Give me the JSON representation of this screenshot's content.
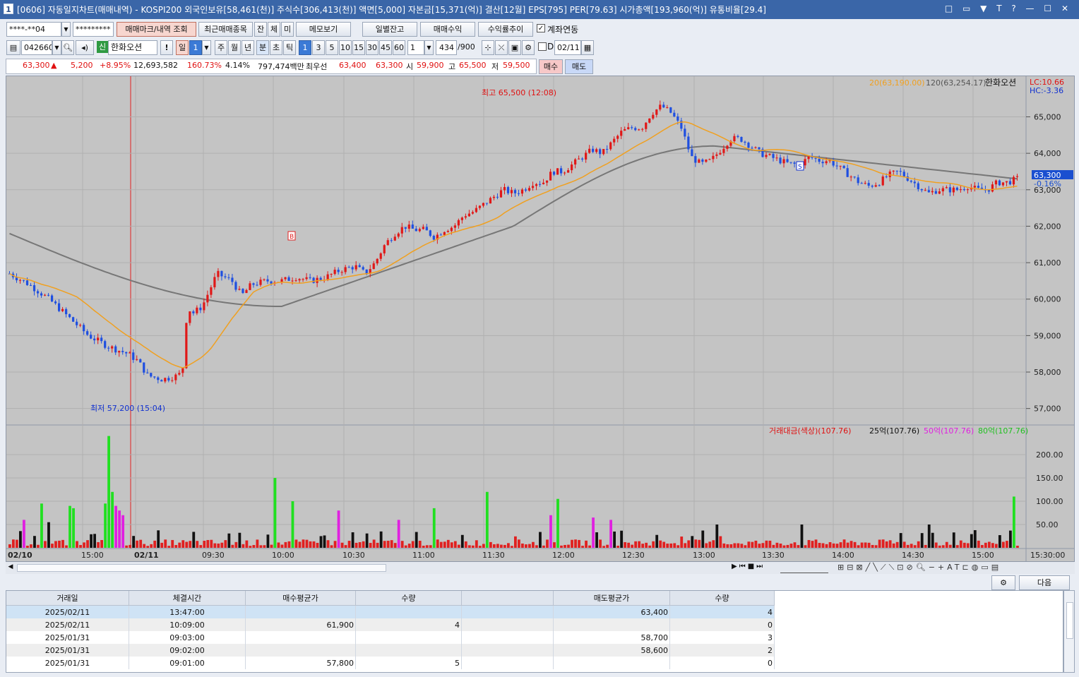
{
  "window": {
    "number": "1",
    "title": "[0606] 자동일지차트(매매내역) - KOSPI200 외국인보유[58,461(천)] 주식수[306,413(천)] 액면[5,000] 자본금[15,371(억)] 결산[12월] EPS[795] PER[79.63] 시가총액[193,960(억)] 유통비율[29.4]",
    "controls": "□ ▭ ▼ T ? — ☐ ✕"
  },
  "toolbar1": {
    "account": "****-**04",
    "password": "*********",
    "btn_trade_mark": "매매마크/내역 조회",
    "btn_recent": "최근매매종목",
    "btn_jan": "잔",
    "btn_che": "체",
    "btn_mi": "미",
    "btn_memo": "메모보기",
    "btn_daily": "일별잔고",
    "btn_profit": "매매수익",
    "btn_profit_trend": "수익률추이",
    "chk_account_link": "계좌연동"
  },
  "toolbar2": {
    "code": "042660",
    "credit_badge": "신",
    "name": "한화오션",
    "excl": "!",
    "period_il": "일",
    "period_il_n": "1",
    "periods": [
      "주",
      "월",
      "년"
    ],
    "min_label": "분",
    "cho_label": "초",
    "tick_label": "틱",
    "intervals": [
      "1",
      "3",
      "5",
      "10",
      "15",
      "30",
      "45",
      "60"
    ],
    "count_sel": "1",
    "bars_count": "434",
    "bars_total": "/900",
    "d_label": "D",
    "date": "02/11"
  },
  "quote": {
    "price": "63,300",
    "arrow": "▲",
    "change": "5,200",
    "pct": "+8.95%",
    "volume": "12,693,582",
    "vol_ratio": "160.73%",
    "turnover": "4.14%",
    "amount": "797,474백만",
    "best_label": "최우선",
    "best_ask": "63,400",
    "best_bid": "63,300",
    "open_label": "시",
    "open": "59,900",
    "high_label": "고",
    "high": "65,500",
    "low_label": "저",
    "low": "59,500",
    "buy_btn": "매수",
    "sell_btn": "매도"
  },
  "chart_data": {
    "type": "candlestick",
    "symbol": "한화오션",
    "legend": {
      "ma20": "20(63,190.00)",
      "ma120": "120(63,254.17)",
      "name": "한화오션",
      "lc": "LC:10.66",
      "hc": "HC:-3.36"
    },
    "price_axis": [
      "65,000",
      "64,000",
      "63,000",
      "62,000",
      "61,000",
      "60,000",
      "59,000",
      "58,000",
      "57,000"
    ],
    "ylim": [
      56800,
      65900
    ],
    "current_price": "63,300",
    "current_pct": "-0.16%",
    "annotations": {
      "high": "최고 65,500 (12:08)",
      "low": "최저 57,200 (15:04)",
      "buy_mark": "B",
      "sell_mark": "S"
    },
    "time_axis": [
      "02/10",
      "15:00",
      "02/11",
      "09:30",
      "10:00",
      "10:30",
      "11:00",
      "11:30",
      "12:00",
      "12:30",
      "13:00",
      "13:30",
      "14:00",
      "14:30",
      "15:00",
      "15:30:00"
    ],
    "close_path": [
      [
        0,
        60700
      ],
      [
        4,
        60400
      ],
      [
        8,
        60000
      ],
      [
        12,
        59500
      ],
      [
        16,
        59000
      ],
      [
        20,
        58700
      ],
      [
        24,
        58500
      ],
      [
        26,
        58300
      ],
      [
        28,
        57900
      ],
      [
        31,
        57800
      ],
      [
        34,
        57900
      ],
      [
        35,
        58000
      ],
      [
        36,
        59800
      ],
      [
        37,
        59600
      ],
      [
        39,
        59800
      ],
      [
        42,
        60700
      ],
      [
        45,
        60500
      ],
      [
        47,
        60100
      ],
      [
        49,
        60400
      ],
      [
        52,
        60500
      ],
      [
        55,
        60500
      ],
      [
        58,
        60600
      ],
      [
        61,
        60500
      ],
      [
        64,
        60600
      ],
      [
        67,
        60800
      ],
      [
        70,
        60900
      ],
      [
        72,
        60700
      ],
      [
        74,
        61000
      ],
      [
        76,
        61500
      ],
      [
        78,
        61800
      ],
      [
        80,
        62000
      ],
      [
        82,
        61900
      ],
      [
        84,
        61900
      ],
      [
        86,
        61700
      ],
      [
        88,
        61900
      ],
      [
        90,
        62000
      ],
      [
        92,
        62300
      ],
      [
        94,
        62400
      ],
      [
        96,
        62600
      ],
      [
        98,
        62800
      ],
      [
        100,
        63000
      ],
      [
        102,
        62900
      ],
      [
        104,
        63000
      ],
      [
        106,
        63200
      ],
      [
        108,
        63200
      ],
      [
        110,
        63500
      ],
      [
        112,
        63500
      ],
      [
        114,
        63700
      ],
      [
        116,
        63900
      ],
      [
        118,
        64100
      ],
      [
        120,
        64000
      ],
      [
        122,
        64300
      ],
      [
        124,
        64600
      ],
      [
        126,
        64700
      ],
      [
        128,
        64700
      ],
      [
        130,
        65100
      ],
      [
        132,
        65300
      ],
      [
        134,
        65100
      ],
      [
        136,
        64700
      ],
      [
        138,
        63900
      ],
      [
        140,
        63700
      ],
      [
        142,
        63800
      ],
      [
        144,
        64100
      ],
      [
        146,
        64400
      ],
      [
        148,
        64400
      ],
      [
        150,
        64200
      ],
      [
        152,
        64000
      ],
      [
        154,
        63900
      ],
      [
        156,
        63800
      ],
      [
        158,
        63700
      ],
      [
        160,
        63700
      ],
      [
        162,
        63900
      ],
      [
        164,
        63800
      ],
      [
        166,
        63800
      ],
      [
        168,
        63600
      ],
      [
        170,
        63400
      ],
      [
        172,
        63200
      ],
      [
        174,
        63100
      ],
      [
        176,
        63200
      ],
      [
        178,
        63400
      ],
      [
        180,
        63500
      ],
      [
        182,
        63300
      ],
      [
        184,
        63100
      ],
      [
        186,
        62900
      ],
      [
        188,
        63000
      ],
      [
        190,
        63000
      ],
      [
        192,
        63000
      ],
      [
        194,
        63100
      ],
      [
        196,
        63000
      ],
      [
        198,
        63000
      ],
      [
        200,
        63200
      ],
      [
        202,
        63200
      ],
      [
        204,
        63300
      ]
    ],
    "ma_note": "approximate",
    "volume_panel": {
      "legend_main": "거래대금(색상)(107.76)",
      "legend_25": "25억(107.76)",
      "legend_50": "50억(107.76)",
      "legend_80": "80억(107.76)",
      "axis": [
        "200.00",
        "150.00",
        "100.00",
        "50.00"
      ],
      "series": [
        {
          "name": "거래대금(색상)",
          "color": "#e02020"
        },
        {
          "name": "25억",
          "color": "#111111"
        },
        {
          "name": "50억",
          "color": "#e020e0"
        },
        {
          "name": "80억",
          "color": "#20e020"
        }
      ],
      "high_bars": [
        {
          "i": 28,
          "v": 240,
          "c": "#20e020"
        },
        {
          "i": 27,
          "v": 95,
          "c": "#20e020"
        },
        {
          "i": 29,
          "v": 120,
          "c": "#20e020"
        },
        {
          "i": 30,
          "v": 90,
          "c": "#e020e0"
        },
        {
          "i": 31,
          "v": 80,
          "c": "#e020e0"
        },
        {
          "i": 32,
          "v": 70,
          "c": "#e020e0"
        },
        {
          "i": 17,
          "v": 90,
          "c": "#20e020"
        },
        {
          "i": 18,
          "v": 85,
          "c": "#20e020"
        },
        {
          "i": 9,
          "v": 95,
          "c": "#20e020"
        },
        {
          "i": 4,
          "v": 60,
          "c": "#e020e0"
        },
        {
          "i": 11,
          "v": 55,
          "c": "#111111"
        },
        {
          "i": 75,
          "v": 150,
          "c": "#20e020"
        },
        {
          "i": 80,
          "v": 100,
          "c": "#20e020"
        },
        {
          "i": 93,
          "v": 80,
          "c": "#e020e0"
        },
        {
          "i": 110,
          "v": 60,
          "c": "#e020e0"
        },
        {
          "i": 120,
          "v": 85,
          "c": "#20e020"
        },
        {
          "i": 135,
          "v": 120,
          "c": "#20e020"
        },
        {
          "i": 155,
          "v": 105,
          "c": "#20e020"
        },
        {
          "i": 153,
          "v": 70,
          "c": "#e020e0"
        },
        {
          "i": 165,
          "v": 65,
          "c": "#e020e0"
        },
        {
          "i": 170,
          "v": 60,
          "c": "#e020e0"
        },
        {
          "i": 200,
          "v": 50,
          "c": "#111111"
        },
        {
          "i": 224,
          "v": 50,
          "c": "#111111"
        },
        {
          "i": 260,
          "v": 50,
          "c": "#111111"
        },
        {
          "i": 284,
          "v": 110,
          "c": "#20e020"
        }
      ]
    }
  },
  "bottom": {
    "settings_icon": "gear-icon",
    "next_btn": "다음"
  },
  "trades_table": {
    "headers": [
      "거래일",
      "체결시간",
      "매수평균가",
      "수량",
      "",
      "매도평균가",
      "수량"
    ],
    "rows": [
      [
        "2025/02/11",
        "13:47:00",
        "",
        "",
        "",
        "63,400",
        "4"
      ],
      [
        "2025/02/11",
        "10:09:00",
        "61,900",
        "4",
        "",
        "",
        "0"
      ],
      [
        "2025/01/31",
        "09:03:00",
        "",
        "",
        "",
        "58,700",
        "3"
      ],
      [
        "2025/01/31",
        "09:02:00",
        "",
        "",
        "",
        "58,600",
        "2"
      ],
      [
        "2025/01/31",
        "09:01:00",
        "57,800",
        "5",
        "",
        "",
        "0"
      ]
    ]
  }
}
